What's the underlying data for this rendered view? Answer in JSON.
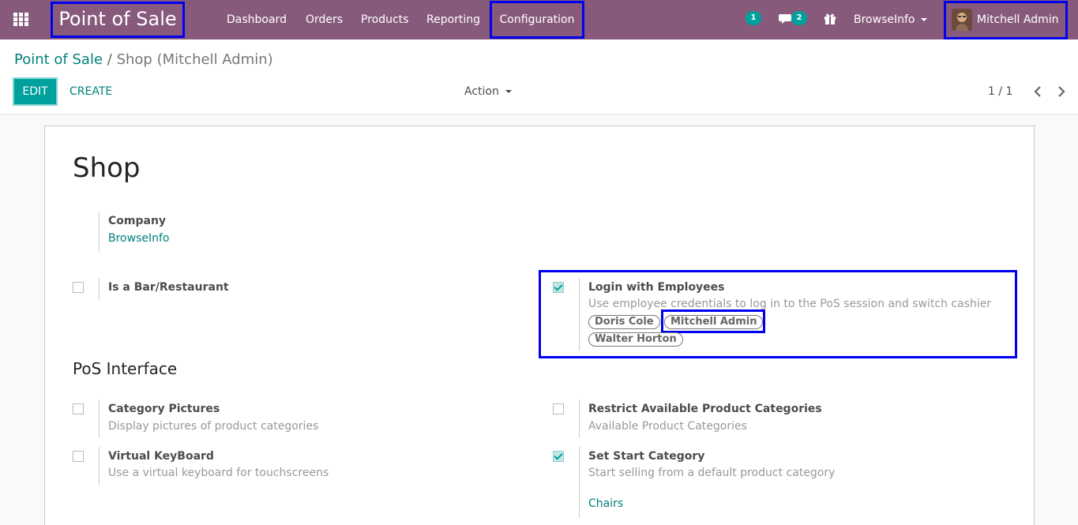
{
  "navbar": {
    "brand": "Point of Sale",
    "menu": [
      "Dashboard",
      "Orders",
      "Products",
      "Reporting",
      "Configuration"
    ],
    "activity_count": "1",
    "messages_count": "2",
    "company": "BrowseInfo",
    "user": "Mitchell Admin"
  },
  "breadcrumb": {
    "parent": "Point of Sale",
    "separator": "/",
    "current": "Shop (Mitchell Admin)"
  },
  "buttons": {
    "edit": "EDIT",
    "create": "CREATE",
    "action": "Action"
  },
  "pager": "1 / 1",
  "form": {
    "name": "Shop",
    "company_label": "Company",
    "company_value": "BrowseInfo",
    "bar_label": "Is a Bar/Restaurant",
    "login_label": "Login with Employees",
    "login_help": "Use employee credentials to log in to the PoS session and switch cashier",
    "employees": [
      "Doris Cole",
      "Mitchell Admin",
      "Walter Horton"
    ],
    "section_title": "PoS Interface",
    "cat_pics_label": "Category Pictures",
    "cat_pics_help": "Display pictures of product categories",
    "restrict_label": "Restrict Available Product Categories",
    "restrict_help": "Available Product Categories",
    "vkb_label": "Virtual KeyBoard",
    "vkb_help": "Use a virtual keyboard for touchscreens",
    "start_cat_label": "Set Start Category",
    "start_cat_help": "Start selling from a default product category",
    "start_cat_value": "Chairs"
  },
  "checkboxes": {
    "is_bar": false,
    "login_employees": true,
    "category_pictures": false,
    "restrict_categories": false,
    "virtual_keyboard": false,
    "start_category": true
  },
  "colors": {
    "navbar": "#875a7b",
    "accent": "#00a09d",
    "link": "#00817d",
    "highlight": "#0000ee"
  }
}
